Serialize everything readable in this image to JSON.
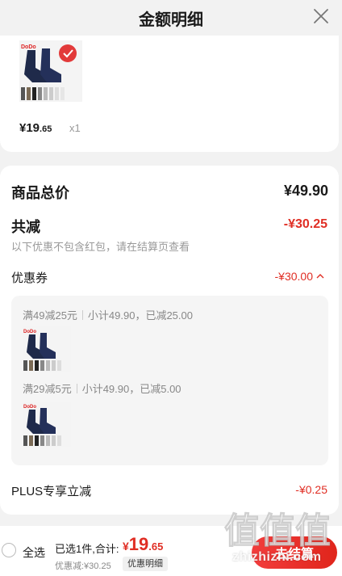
{
  "header": {
    "title": "金额明细"
  },
  "product": {
    "price_int": "¥19",
    "price_dec": ".65",
    "qty": "x1",
    "thumb_brand": "DoDo"
  },
  "summary": {
    "goods_total_label": "商品总价",
    "goods_total_value": "¥49.90",
    "total_discount_label": "共减",
    "total_discount_value": "-¥30.25",
    "discount_note": "以下优惠不包含红包，请在结算页查看",
    "coupon_label": "优惠券",
    "coupon_value": "-¥30.00",
    "coupons": [
      {
        "name": "满49减25元",
        "detail": "小计49.90，已减25.00"
      },
      {
        "name": "满29减5元",
        "detail": "小计49.90，已减5.00"
      }
    ],
    "plus_label": "PLUS专享立减",
    "plus_value": "-¥0.25"
  },
  "bottom": {
    "select_all": "全选",
    "selected_info": "已选1件,合计:",
    "total_sym": "¥",
    "total_int": "19",
    "total_dec": ".65",
    "discount_info": "优惠减:¥30.25",
    "detail_chip": "优惠明细",
    "checkout": "去结算"
  },
  "watermark": {
    "text": "zhizhizhi.com",
    "logo_glyph": "值值值"
  },
  "colors": {
    "accent_red": "#e02e24",
    "background": "#f2f2f2"
  }
}
